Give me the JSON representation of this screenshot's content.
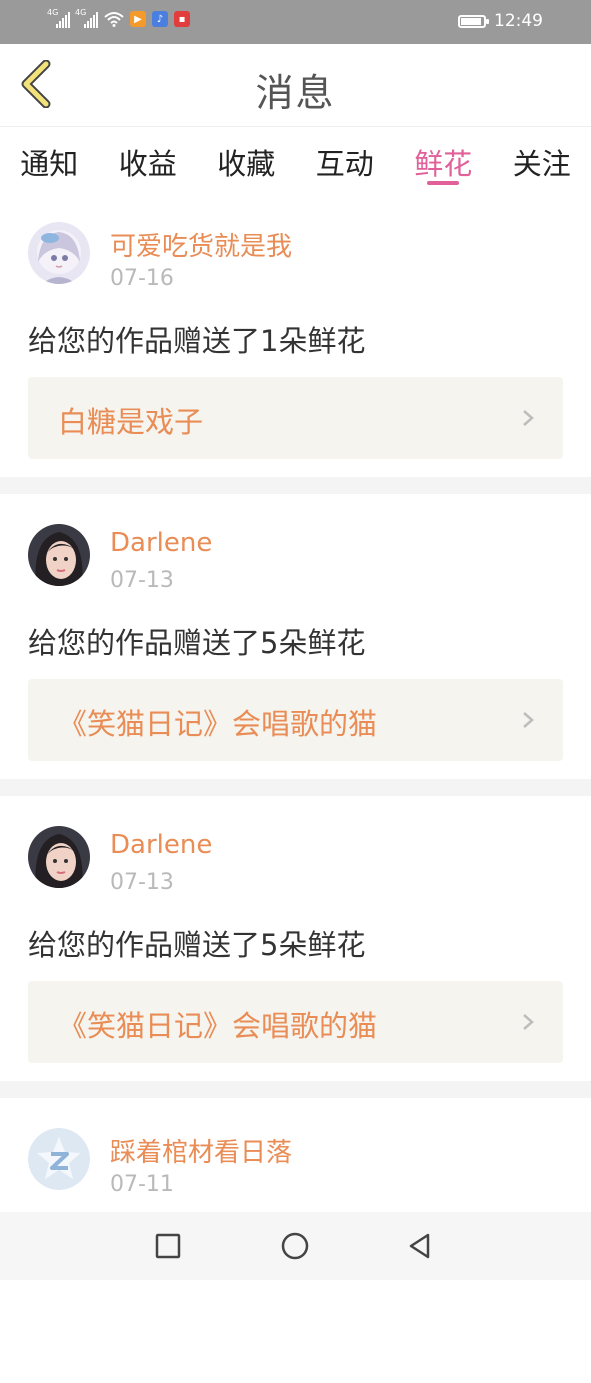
{
  "status_bar": {
    "time": "12:49",
    "network_label_1": "4G",
    "network_label_2": "4G",
    "battery_level": 0.9
  },
  "header": {
    "title": "消息"
  },
  "tabs": [
    {
      "label": "通知",
      "active": false
    },
    {
      "label": "收益",
      "active": false
    },
    {
      "label": "收藏",
      "active": false
    },
    {
      "label": "互动",
      "active": false
    },
    {
      "label": "鲜花",
      "active": true
    },
    {
      "label": "关注",
      "active": false
    }
  ],
  "messages": [
    {
      "username": "可爱吃货就是我",
      "date": "07-16",
      "text": "给您的作品赠送了1朵鲜花",
      "work_title": "白糖是戏子",
      "avatar": "anime-avatar"
    },
    {
      "username": "Darlene",
      "date": "07-13",
      "text": "给您的作品赠送了5朵鲜花",
      "work_title": "《笑猫日记》会唱歌的猫",
      "avatar": "photo-avatar"
    },
    {
      "username": "Darlene",
      "date": "07-13",
      "text": "给您的作品赠送了5朵鲜花",
      "work_title": "《笑猫日记》会唱歌的猫",
      "avatar": "photo-avatar"
    },
    {
      "username": "踩着棺材看日落",
      "date": "07-11",
      "text": "",
      "work_title": "",
      "avatar": "default-avatar"
    }
  ],
  "colors": {
    "accent": "#e1609a",
    "username": "#e98c55",
    "back_arrow": "#f3e27a"
  },
  "icons": {
    "back": "back-arrow-icon",
    "chevron": "chevron-right-icon",
    "nav": [
      "recents-square-icon",
      "home-circle-icon",
      "back-triangle-icon"
    ]
  }
}
